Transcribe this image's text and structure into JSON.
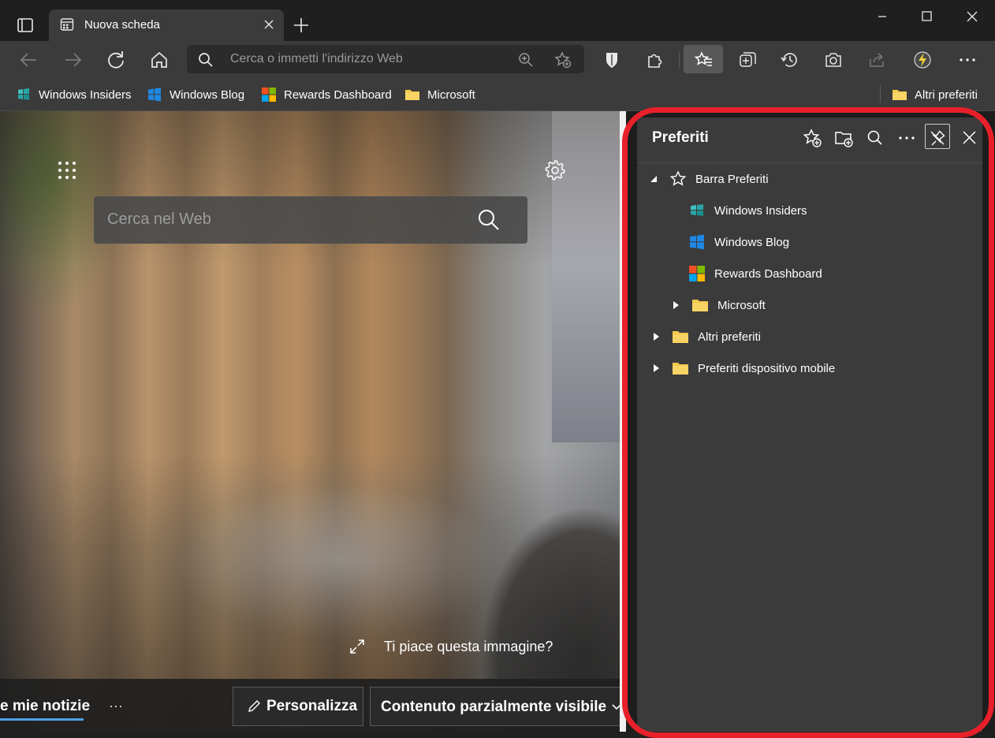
{
  "tab": {
    "title": "Nuova scheda"
  },
  "address_bar": {
    "placeholder": "Cerca o immetti l'indirizzo Web"
  },
  "favorites_bar": {
    "items": [
      {
        "label": "Windows Insiders",
        "icon": "windows-insider-icon"
      },
      {
        "label": "Windows Blog",
        "icon": "windows-logo-icon"
      },
      {
        "label": "Rewards Dashboard",
        "icon": "microsoft-logo-icon"
      },
      {
        "label": "Microsoft",
        "icon": "folder-icon"
      }
    ],
    "other": {
      "label": "Altri preferiti",
      "icon": "folder-icon"
    }
  },
  "new_tab_page": {
    "search_placeholder": "Cerca nel Web",
    "like_image": "Ti piace questa immagine?",
    "news_tab": "e mie notizie",
    "more": "···",
    "customize_button": "Personalizza",
    "content_button": "Contenuto parzialmente visibile"
  },
  "favorites_panel": {
    "title": "Preferiti",
    "tree": [
      {
        "label": "Barra Preferiti",
        "expanded": true,
        "icon": "star-icon"
      },
      {
        "label": "Windows Insiders",
        "icon": "windows-insider-icon"
      },
      {
        "label": "Windows Blog",
        "icon": "windows-logo-icon"
      },
      {
        "label": "Rewards Dashboard",
        "icon": "microsoft-logo-icon"
      },
      {
        "label": "Microsoft",
        "expanded": false,
        "icon": "folder-icon"
      },
      {
        "label": "Altri preferiti",
        "expanded": false,
        "icon": "folder-icon"
      },
      {
        "label": "Preferiti dispositivo mobile",
        "expanded": false,
        "icon": "folder-icon"
      }
    ]
  },
  "colors": {
    "highlight": "#e8202a",
    "folder": "#f3c84b",
    "accent": "#4fa0e8"
  }
}
